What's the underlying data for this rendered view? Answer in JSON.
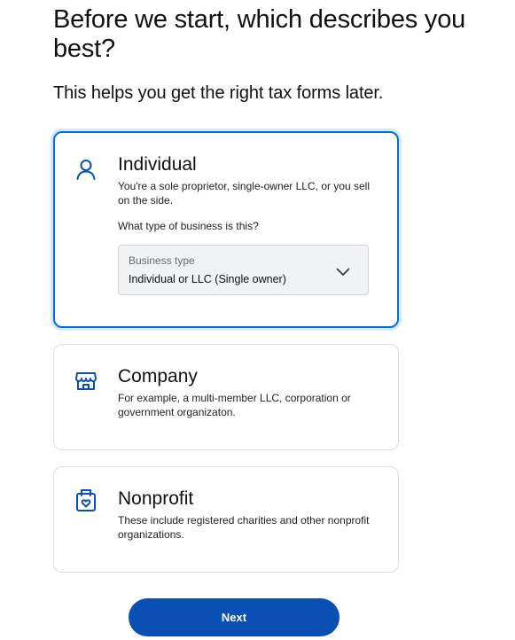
{
  "header": {
    "title": "Before we start, which describes you best?",
    "subtitle": "This helps you get the right tax forms later."
  },
  "options": [
    {
      "title": "Individual",
      "description": "You're a sole proprietor, single-owner LLC, or you sell on the side.",
      "icon": "person-icon",
      "selected": true,
      "question": "What type of business is this?",
      "select": {
        "label": "Business type",
        "value": "Individual or LLC (Single owner)"
      }
    },
    {
      "title": "Company",
      "description": "For example, a multi-member LLC, corporation or government organizaton.",
      "icon": "storefront-icon",
      "selected": false
    },
    {
      "title": "Nonprofit",
      "description": "These include registered charities and other nonprofit organizations.",
      "icon": "donation-box-icon",
      "selected": false
    }
  ],
  "footer": {
    "next_label": "Next"
  },
  "colors": {
    "accent": "#0070e0",
    "button": "#0a4fb3",
    "selected_glow": "#d6e6fb",
    "icon": "#0a4fb3"
  }
}
